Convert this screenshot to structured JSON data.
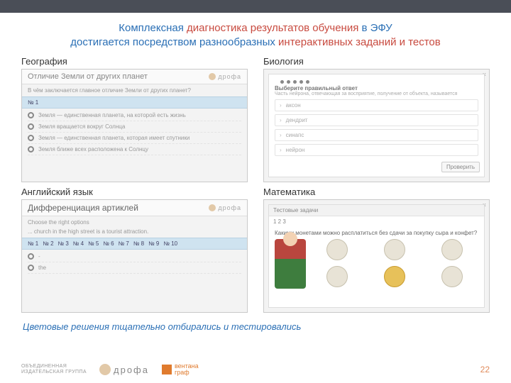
{
  "title": {
    "line1_a": "Комплексная ",
    "line1_b": "диагностика результатов обучения ",
    "line1_c": "в ЭФУ",
    "line2_a": "достигается посредством разнообразных ",
    "line2_b": "интерактивных заданий и тестов"
  },
  "labels": {
    "geo": "География",
    "bio": "Биология",
    "eng": "Английский язык",
    "math": "Математика"
  },
  "geo": {
    "heading": "Отличие Земли от других планет",
    "question": "В чём заключается главное отличие Земли от других планет?",
    "tab": "№ 1",
    "brand": "дрофа",
    "options": [
      "Земля — единственная планета, на которой есть жизнь",
      "Земля вращается вокруг Солнца",
      "Земля — единственная планета, которая имеет спутники",
      "Земля ближе всех расположена к Солнцу"
    ]
  },
  "bio": {
    "instruction": "Выберите правильный ответ",
    "subtext": "Часть нейрона, отвечающая за восприятие, получение от объекта, называется",
    "items": [
      "аксон",
      "дендрит",
      "синапс",
      "нейрон"
    ],
    "button": "Проверить",
    "page": "1"
  },
  "eng": {
    "heading": "Дифференциация артиклей",
    "sub": "Choose the right options",
    "sentence": "... church in the high street is a tourist attraction.",
    "brand": "дрофа",
    "tabs": [
      "№ 1",
      "№ 2",
      "№ 3",
      "№ 4",
      "№ 5",
      "№ 6",
      "№ 7",
      "№ 8",
      "№ 9",
      "№ 10"
    ],
    "options": [
      "-",
      "the"
    ]
  },
  "math": {
    "top": "Тестовые задачи",
    "nums": "1   2   3",
    "question": "Какими монетами можно расплатиться без сдачи за покупку сыра и конфет?"
  },
  "note": "Цветовые решения тщательно отбирались и тестировались",
  "footer": {
    "publisher": "ОБЪЕДИНЕННАЯ\nИЗДАТЕЛЬСКАЯ ГРУППА",
    "drofa": "дрофа",
    "ventana1": "вентана",
    "ventana2": "граф",
    "page": "22"
  }
}
